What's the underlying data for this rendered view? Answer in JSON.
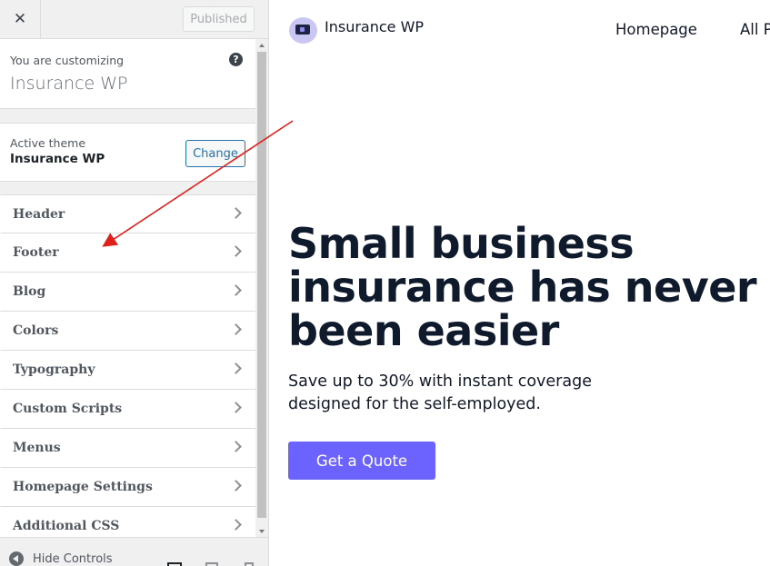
{
  "sidebar": {
    "close_icon": "close-icon",
    "published_label": "Published",
    "customizing_label": "You are customizing",
    "site_name": "Insurance WP",
    "help_glyph": "?",
    "active_theme_label": "Active theme",
    "theme_name": "Insurance WP",
    "change_label": "Change",
    "panels": [
      {
        "label": "Header"
      },
      {
        "label": "Footer"
      },
      {
        "label": "Blog"
      },
      {
        "label": "Colors"
      },
      {
        "label": "Typography"
      },
      {
        "label": "Custom Scripts"
      },
      {
        "label": "Menus"
      },
      {
        "label": "Homepage Settings"
      },
      {
        "label": "Additional CSS"
      }
    ],
    "hide_controls_label": "Hide Controls"
  },
  "preview": {
    "site_title": "Insurance WP",
    "nav": [
      "Homepage",
      "All P"
    ],
    "hero_title": "Small business insurance has never been easier",
    "hero_subtitle": "Save up to 30% with instant coverage designed for the self-employed.",
    "cta_label": "Get a Quote",
    "accent_color": "#6c63ff"
  },
  "annotation": {
    "arrow_color": "#e0201b"
  }
}
